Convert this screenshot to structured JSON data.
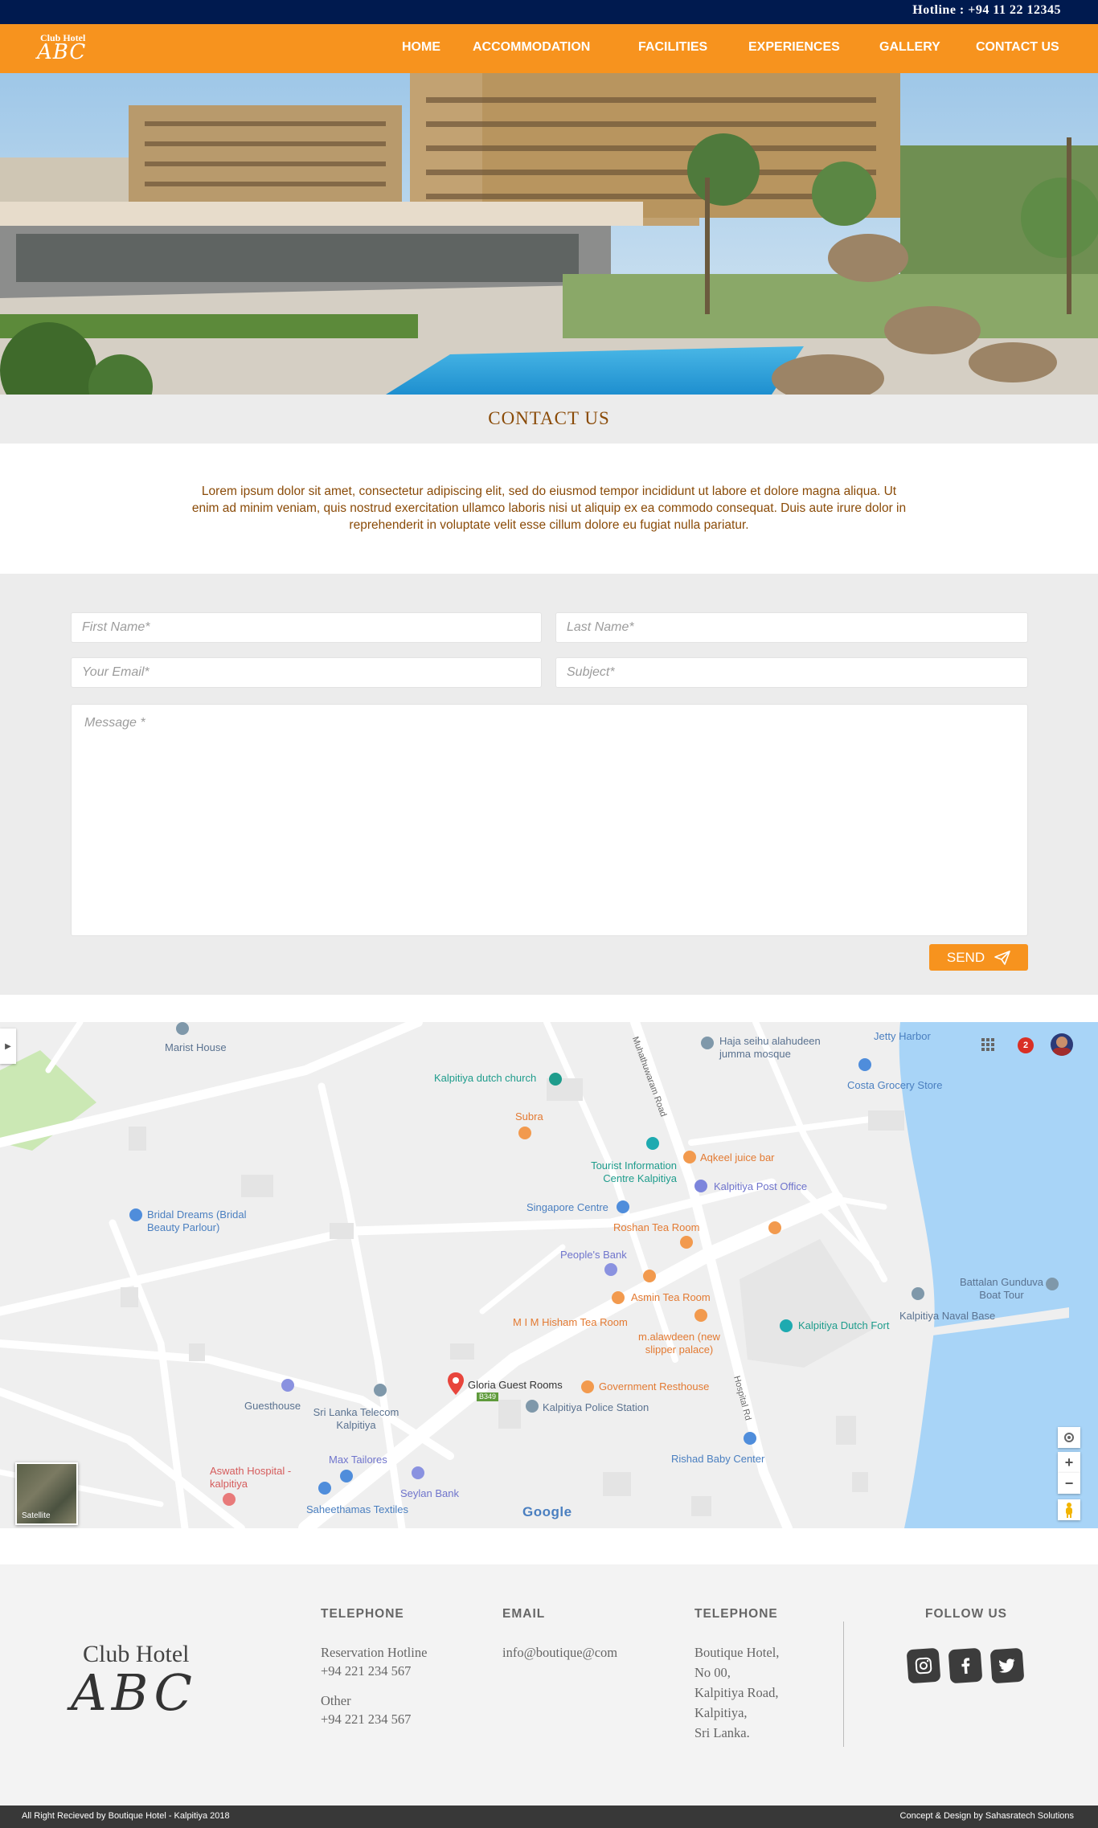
{
  "header": {
    "hotline": "Hotline : +94 11 22 12345",
    "logo_top": "Club Hotel",
    "logo_bottom": "ABC"
  },
  "nav": {
    "items": [
      "HOME",
      "ACCOMMODATION",
      "FACILITIES",
      "EXPERIENCES",
      "GALLERY",
      "CONTACT US"
    ]
  },
  "page": {
    "title": "CONTACT US",
    "intro": "Lorem ipsum dolor sit amet, consectetur adipiscing elit, sed do eiusmod tempor incididunt ut labore et dolore magna aliqua. Ut enim ad minim veniam, quis nostrud exercitation ullamco laboris nisi ut aliquip ex ea commodo consequat. Duis aute irure dolor in reprehenderit in voluptate velit esse cillum dolore eu fugiat nulla pariatur."
  },
  "form": {
    "first_name_placeholder": "First Name*",
    "last_name_placeholder": "Last Name*",
    "email_placeholder": "Your Email*",
    "subject_placeholder": "Subject*",
    "message_placeholder": "Message *",
    "send_label": "SEND"
  },
  "map": {
    "labels": {
      "marist_house": "Marist House",
      "kalpitiya_dutch_church": "Kalpitiya dutch church",
      "haja_mosque": "Haja seihu alahudeen jumma mosque",
      "jetty_harbor": "Jetty Harbor",
      "costa_grocery": "Costa Grocery Store",
      "subra": "Subra",
      "tourist_info": "Tourist Information Centre Kalpitiya",
      "aqkeel_juice": "Aqkeel juice bar",
      "post_office": "Kalpitiya Post Office",
      "singapore_centre": "Singapore Centre",
      "roshan_tea": "Roshan Tea Room",
      "bridal_dreams": "Bridal Dreams (Bridal Beauty Parlour)",
      "peoples_bank": "People's Bank",
      "asmin_tea": "Asmin Tea Room",
      "mim_hisham": "M I M Hisham Tea Room",
      "alawdeen": "m.alawdeen (new slipper palace)",
      "dutch_fort": "Kalpitiya Dutch Fort",
      "battalan": "Battalan Gunduva Boat Tour",
      "naval_base": "Kalpitiya Naval Base",
      "guesthouse": "Guesthouse",
      "sri_lanka_telecom": "Sri Lanka Telecom Kalpitiya",
      "gloria": "Gloria Guest Rooms",
      "b349": "B349",
      "government_resthouse": "Government Resthouse",
      "police_station": "Kalpitiya Police Station",
      "aswath_hospital": "Aswath Hospital - kalpitiya",
      "max_tailores": "Max Tailores",
      "rishad_baby": "Rishad Baby Center",
      "seylan_bank": "Seylan Bank",
      "saheethamas": "Saheethamas Textiles",
      "road_muhathuwaram": "Muhathuwaram Road",
      "road_hospital": "Hospital Rd",
      "satellite": "Satellite",
      "google": "Google",
      "notification_count": "2"
    }
  },
  "footer": {
    "logo_top": "Club Hotel",
    "logo_bottom": "ABC",
    "telephone_heading": "TELEPHONE",
    "reservation_label": "Reservation Hotline",
    "reservation_number": "+94 221 234 567",
    "other_label": "Other",
    "other_number": "+94 221 234 567",
    "email_heading": "EMAIL",
    "email_value": "info@boutique@com",
    "address_heading": "TELEPHONE",
    "address_lines": [
      "Boutique Hotel,",
      "No 00,",
      "Kalpitiya Road,",
      "Kalpitiya,",
      "Sri Lanka."
    ],
    "follow_heading": "FOLLOW US",
    "copyright": "All Right Recieved by Boutique Hotel - Kalpitiya 2018",
    "credit": "Concept & Design by Sahasratech Solutions"
  },
  "colors": {
    "topbar": "#001a4f",
    "nav_orange": "#f7931e",
    "title_brown": "#8a4b08"
  },
  "icons": [
    "send-icon",
    "instagram-icon",
    "facebook-icon",
    "twitter-icon",
    "apps-grid-icon",
    "my-location-icon",
    "zoom-in-icon",
    "zoom-out-icon",
    "pegman-icon",
    "map-pin-icon"
  ]
}
